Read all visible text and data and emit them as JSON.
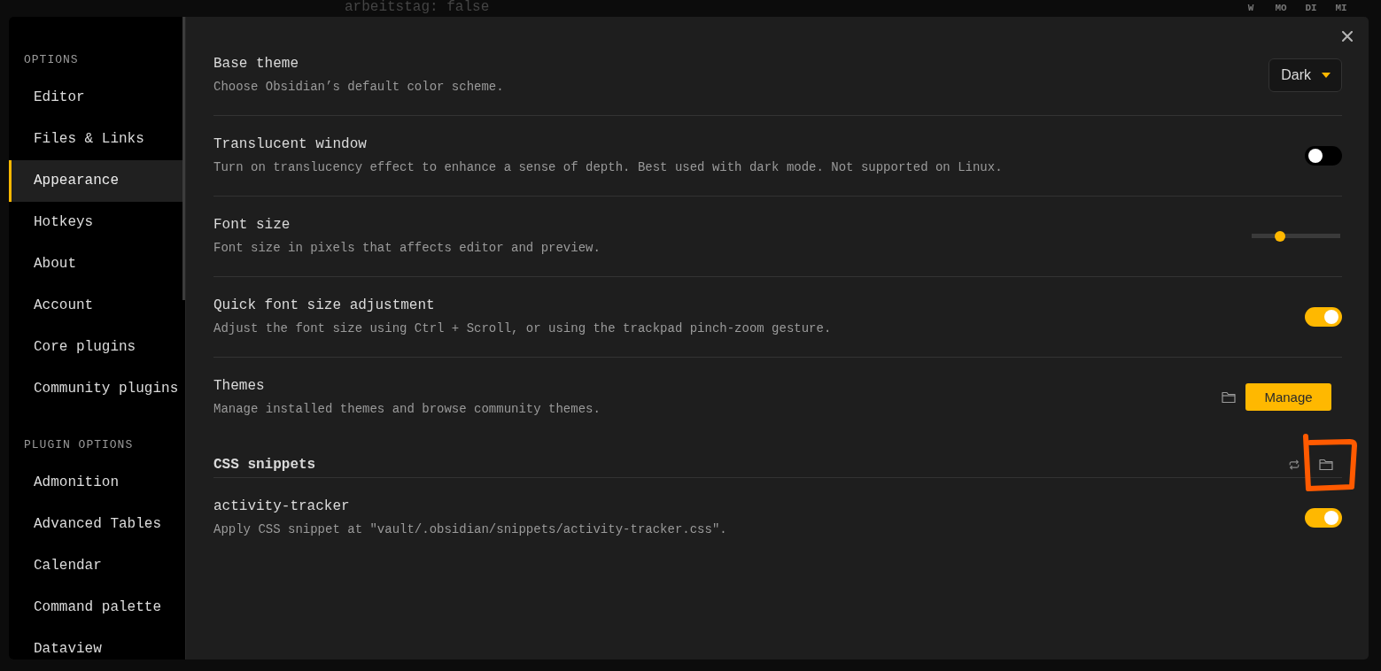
{
  "background": {
    "note_line": "arbeitstag: false",
    "calendar_header": [
      "W",
      "MO",
      "DI",
      "MI"
    ]
  },
  "sidebar": {
    "sections": [
      {
        "title": "OPTIONS",
        "items": [
          {
            "label": "Editor",
            "selected": false
          },
          {
            "label": "Files & Links",
            "selected": false
          },
          {
            "label": "Appearance",
            "selected": true
          },
          {
            "label": "Hotkeys",
            "selected": false
          },
          {
            "label": "About",
            "selected": false
          },
          {
            "label": "Account",
            "selected": false
          },
          {
            "label": "Core plugins",
            "selected": false
          },
          {
            "label": "Community plugins",
            "selected": false
          }
        ]
      },
      {
        "title": "PLUGIN OPTIONS",
        "items": [
          {
            "label": "Admonition",
            "selected": false
          },
          {
            "label": "Advanced Tables",
            "selected": false
          },
          {
            "label": "Calendar",
            "selected": false
          },
          {
            "label": "Command palette",
            "selected": false
          },
          {
            "label": "Dataview",
            "selected": false
          }
        ]
      }
    ]
  },
  "settings": [
    {
      "kind": "dropdown",
      "name": "Base theme",
      "description": "Choose Obsidian’s default color scheme.",
      "value": "Dark"
    },
    {
      "kind": "toggle",
      "name": "Translucent window",
      "description": "Turn on translucency effect to enhance a sense of depth. Best used with dark mode. Not supported on Linux.",
      "on": false
    },
    {
      "kind": "slider",
      "name": "Font size",
      "description": "Font size in pixels that affects editor and preview.",
      "level": 0.3
    },
    {
      "kind": "toggle",
      "name": "Quick font size adjustment",
      "description": "Adjust the font size using Ctrl + Scroll, or using the trackpad pinch-zoom gesture.",
      "on": true
    },
    {
      "kind": "button",
      "name": "Themes",
      "description": "Manage installed themes and browse community themes.",
      "button": "Manage"
    }
  ],
  "snippets": {
    "heading": "CSS snippets",
    "items": [
      {
        "kind": "toggle",
        "name": "activity-tracker",
        "description": "Apply CSS snippet at \"vault/.obsidian/snippets/activity-tracker.css\".",
        "on": true
      }
    ]
  }
}
